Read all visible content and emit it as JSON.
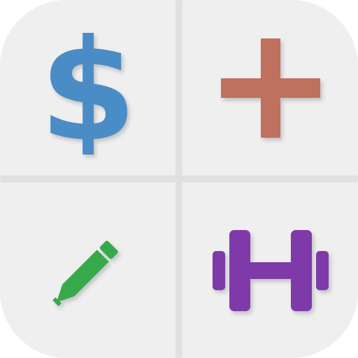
{
  "icon": {
    "tiles": [
      {
        "symbol": "$",
        "icon": "dollar-sign-icon",
        "color": "#4a8cc5"
      },
      {
        "symbol": "",
        "icon": "plus-icon",
        "color": "#c0705f"
      },
      {
        "symbol": "",
        "icon": "pencil-icon",
        "color": "#36aa4a"
      },
      {
        "symbol": "",
        "icon": "dumbbell-icon",
        "color": "#7f3aaa"
      }
    ],
    "tile_background": "#efefef",
    "divider_color": "#e0e0e0"
  }
}
